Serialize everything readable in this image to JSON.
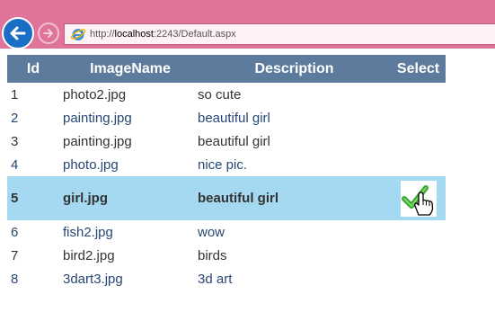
{
  "browser": {
    "url_prefix": "http://",
    "url_host": "localhost",
    "url_rest": ":2243/Default.aspx"
  },
  "grid": {
    "headers": {
      "id": "Id",
      "image_name": "ImageName",
      "description": "Description",
      "select": "Select"
    },
    "rows": [
      {
        "id": "1",
        "image_name": "photo2.jpg",
        "description": "so cute"
      },
      {
        "id": "2",
        "image_name": "painting.jpg",
        "description": "beautiful girl"
      },
      {
        "id": "3",
        "image_name": "painting.jpg",
        "description": "beautiful girl"
      },
      {
        "id": "4",
        "image_name": "photo.jpg",
        "description": "nice pic."
      },
      {
        "id": "5",
        "image_name": "girl.jpg",
        "description": "beautiful girl"
      },
      {
        "id": "6",
        "image_name": "fish2.jpg",
        "description": "wow"
      },
      {
        "id": "7",
        "image_name": "bird2.jpg",
        "description": "birds"
      },
      {
        "id": "8",
        "image_name": "3dart3.jpg",
        "description": "3d art"
      }
    ],
    "selected_row_id": "5",
    "select_icon": "checkmark-hand-cursor-icon"
  },
  "colors": {
    "header_bg": "#5d7b9d",
    "selected_row_bg": "#a5d9f1",
    "alt_row_text": "#284775",
    "row_text": "#333333",
    "browser_frame": "#e0739a"
  }
}
